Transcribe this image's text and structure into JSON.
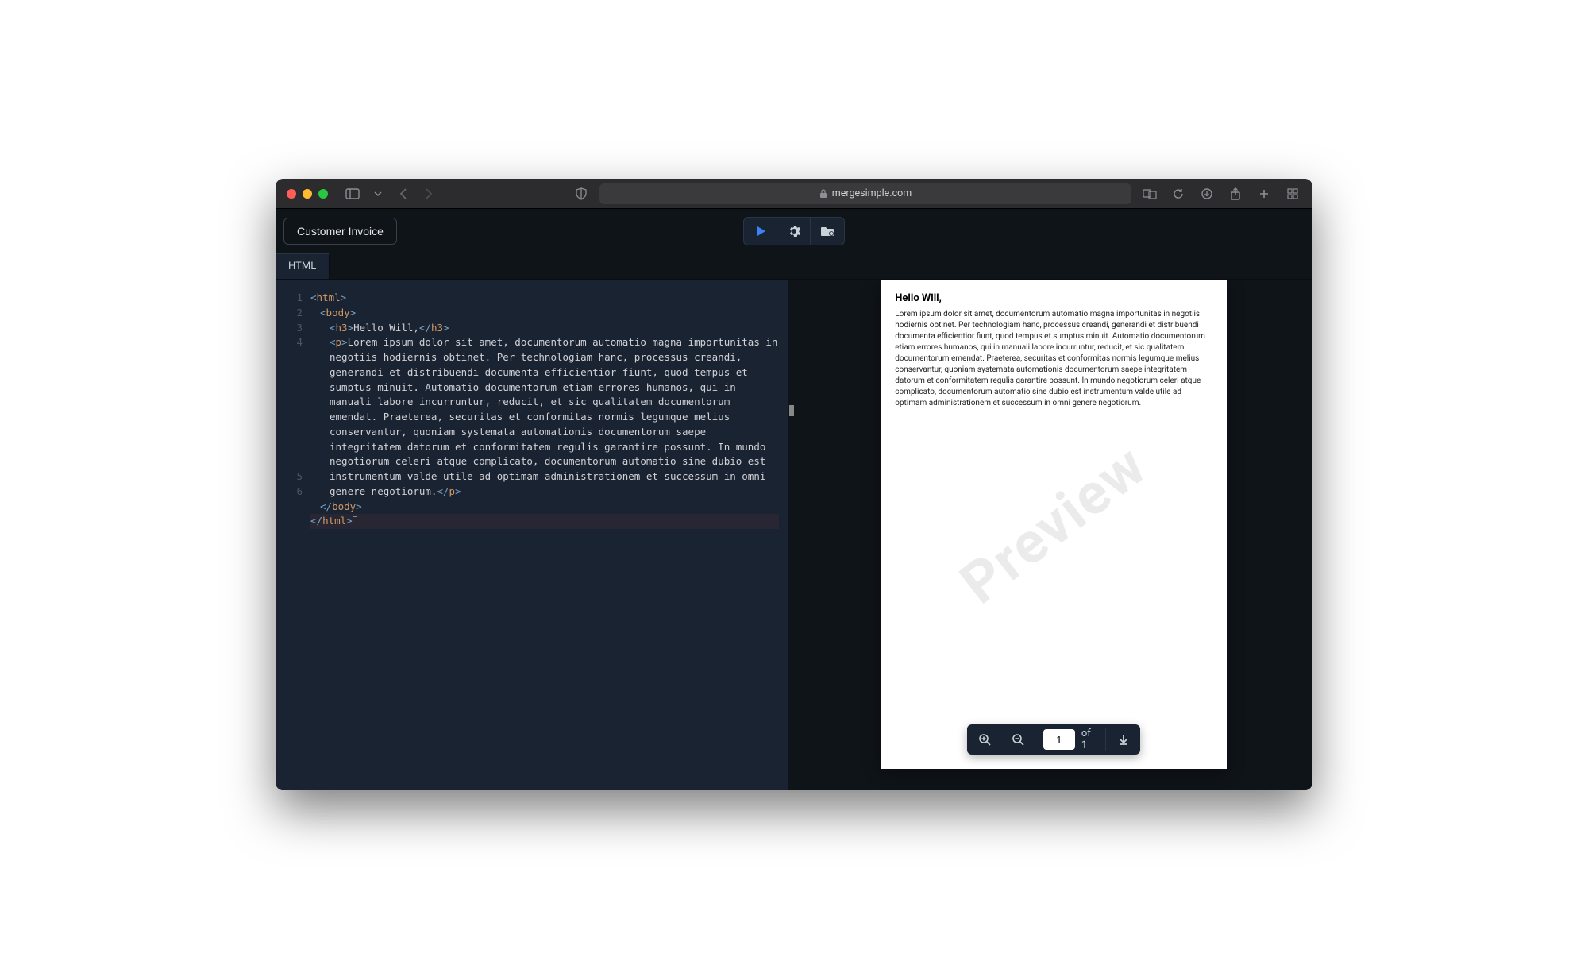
{
  "browser": {
    "url_display": "mergesimple.com"
  },
  "toolbar": {
    "doc_name": "Customer Invoice"
  },
  "tabs": {
    "active": "HTML"
  },
  "editor": {
    "line_numbers": [
      "1",
      "2",
      "3",
      "4",
      "",
      "",
      "",
      "",
      "",
      "",
      "",
      "",
      "5",
      "6"
    ],
    "lines": [
      {
        "indent": "ind1",
        "parts": [
          {
            "t": "br",
            "v": "<"
          },
          {
            "t": "name",
            "v": "html"
          },
          {
            "t": "br",
            "v": ">"
          }
        ]
      },
      {
        "indent": "ind2",
        "parts": [
          {
            "t": "br",
            "v": "<"
          },
          {
            "t": "name",
            "v": "body"
          },
          {
            "t": "br",
            "v": ">"
          }
        ]
      },
      {
        "indent": "ind3",
        "parts": [
          {
            "t": "br",
            "v": "<"
          },
          {
            "t": "name",
            "v": "h3"
          },
          {
            "t": "br",
            "v": ">"
          },
          {
            "t": "txt",
            "v": "Hello Will,"
          },
          {
            "t": "br",
            "v": "</"
          },
          {
            "t": "name",
            "v": "h3"
          },
          {
            "t": "br",
            "v": ">"
          }
        ]
      },
      {
        "indent": "ind3",
        "wrap": true,
        "parts": [
          {
            "t": "br",
            "v": "<"
          },
          {
            "t": "name",
            "v": "p"
          },
          {
            "t": "br",
            "v": ">"
          },
          {
            "t": "txt",
            "v": "Lorem ipsum dolor sit amet, documentorum automatio magna importunitas in negotiis hodiernis obtinet. Per technologiam hanc, processus creandi, generandi et distribuendi documenta efficientior fiunt, quod tempus et sumptus minuit. Automatio documentorum etiam errores humanos, qui in manuali labore incurruntur, reducit, et sic qualitatem documentorum emendat. Praeterea, securitas et conformitas normis legumque melius conservantur, quoniam systemata automationis documentorum saepe integritatem datorum et conformitatem regulis garantire possunt. In mundo negotiorum celeri atque complicato, documentorum automatio sine dubio est instrumentum valde utile ad optimam administrationem et successum in omni genere negotiorum."
          },
          {
            "t": "br",
            "v": "</"
          },
          {
            "t": "name",
            "v": "p"
          },
          {
            "t": "br",
            "v": ">"
          }
        ]
      },
      {
        "indent": "ind2",
        "parts": [
          {
            "t": "br",
            "v": "</"
          },
          {
            "t": "name",
            "v": "body"
          },
          {
            "t": "br",
            "v": ">"
          }
        ]
      },
      {
        "indent": "ind1",
        "hl": true,
        "cursor": true,
        "parts": [
          {
            "t": "br",
            "v": "</"
          },
          {
            "t": "name",
            "v": "html"
          },
          {
            "t": "br",
            "v": ">"
          }
        ]
      }
    ]
  },
  "preview": {
    "heading": "Hello Will,",
    "body": "Lorem ipsum dolor sit amet, documentorum automatio magna importunitas in negotiis hodiernis obtinet. Per technologiam hanc, processus creandi, generandi et distribuendi documenta efficientior fiunt, quod tempus et sumptus minuit. Automatio documentorum etiam errores humanos, qui in manuali labore incurruntur, reducit, et sic qualitatem documentorum emendat. Praeterea, securitas et conformitas normis legumque melius conservantur, quoniam systemata automationis documentorum saepe integritatem datorum et conformitatem regulis garantire possunt. In mundo negotiorum celeri atque complicato, documentorum automatio sine dubio est instrumentum valde utile ad optimam administrationem et successum in omni genere negotiorum.",
    "watermark": "Preview"
  },
  "pdf_controls": {
    "page_input": "1",
    "page_total_label": "of 1"
  }
}
